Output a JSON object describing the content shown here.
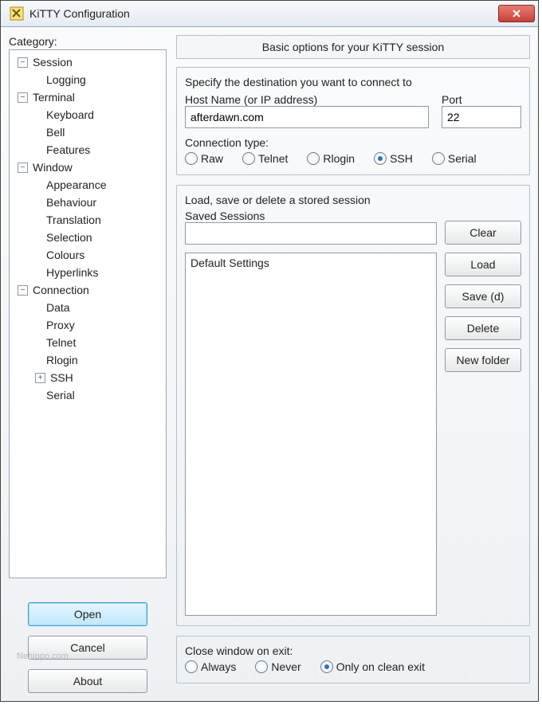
{
  "window": {
    "title": "KiTTY Configuration"
  },
  "category": {
    "label": "Category:",
    "tree": [
      {
        "label": "Session",
        "level": 0,
        "toggle": "minus"
      },
      {
        "label": "Logging",
        "level": 1,
        "toggle": "leaf"
      },
      {
        "label": "Terminal",
        "level": 0,
        "toggle": "minus"
      },
      {
        "label": "Keyboard",
        "level": 1,
        "toggle": "leaf"
      },
      {
        "label": "Bell",
        "level": 1,
        "toggle": "leaf"
      },
      {
        "label": "Features",
        "level": 1,
        "toggle": "leaf"
      },
      {
        "label": "Window",
        "level": 0,
        "toggle": "minus"
      },
      {
        "label": "Appearance",
        "level": 1,
        "toggle": "leaf"
      },
      {
        "label": "Behaviour",
        "level": 1,
        "toggle": "leaf"
      },
      {
        "label": "Translation",
        "level": 1,
        "toggle": "leaf"
      },
      {
        "label": "Selection",
        "level": 1,
        "toggle": "leaf"
      },
      {
        "label": "Colours",
        "level": 1,
        "toggle": "leaf"
      },
      {
        "label": "Hyperlinks",
        "level": 1,
        "toggle": "leaf"
      },
      {
        "label": "Connection",
        "level": 0,
        "toggle": "minus"
      },
      {
        "label": "Data",
        "level": 1,
        "toggle": "leaf"
      },
      {
        "label": "Proxy",
        "level": 1,
        "toggle": "leaf"
      },
      {
        "label": "Telnet",
        "level": 1,
        "toggle": "leaf"
      },
      {
        "label": "Rlogin",
        "level": 1,
        "toggle": "leaf"
      },
      {
        "label": "SSH",
        "level": 1,
        "toggle": "plus"
      },
      {
        "label": "Serial",
        "level": 1,
        "toggle": "leaf"
      }
    ]
  },
  "left_buttons": {
    "open": "Open",
    "cancel": "Cancel",
    "about": "About"
  },
  "panel": {
    "header": "Basic options for your KiTTY session",
    "destination": {
      "group_label": "Specify the destination you want to connect to",
      "host_label": "Host Name (or IP address)",
      "host_value": "afterdawn.com",
      "port_label": "Port",
      "port_value": "22",
      "conn_type_label": "Connection type:",
      "options": [
        "Raw",
        "Telnet",
        "Rlogin",
        "SSH",
        "Serial"
      ],
      "selected": "SSH"
    },
    "sessions": {
      "group_label": "Load, save or delete a stored session",
      "saved_label": "Saved Sessions",
      "saved_value": "",
      "list": [
        "Default Settings"
      ],
      "buttons": {
        "clear": "Clear",
        "load": "Load",
        "save": "Save (d)",
        "delete": "Delete",
        "newfolder": "New folder"
      }
    },
    "close_on_exit": {
      "label": "Close window on exit:",
      "options": [
        "Always",
        "Never",
        "Only on clean exit"
      ],
      "selected": "Only on clean exit"
    }
  },
  "watermark": "filehippo.com"
}
